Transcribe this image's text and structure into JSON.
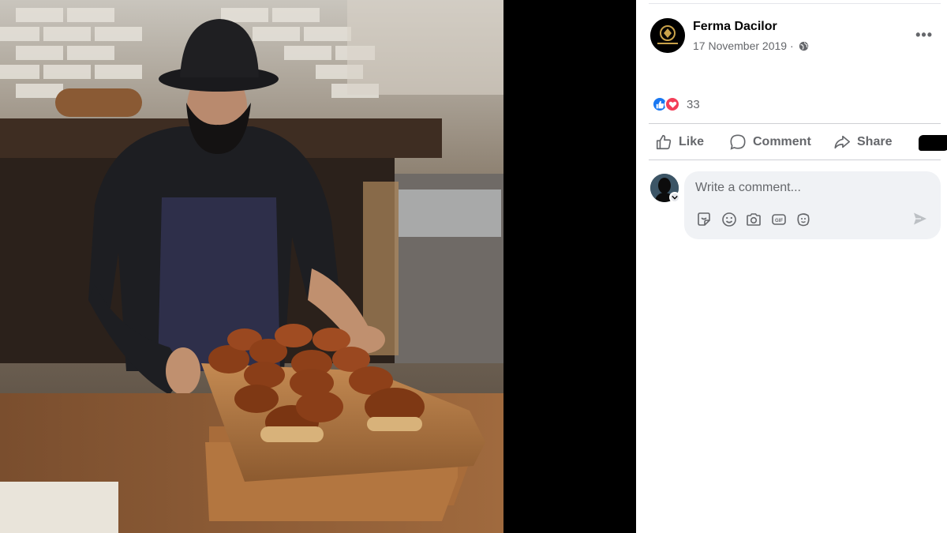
{
  "post": {
    "page_name": "Ferma Dacilor",
    "date": "17 November 2019",
    "date_separator": " · ",
    "more_label": "•••",
    "reaction_count": "33"
  },
  "actions": {
    "like": "Like",
    "comment": "Comment",
    "share": "Share"
  },
  "comment": {
    "placeholder": "Write a comment..."
  },
  "colors": {
    "like_blue": "#1877f2",
    "love_red": "#f33e58",
    "secondary_text": "#65676b",
    "input_bg": "#f0f2f5"
  },
  "icons": [
    "globe-icon",
    "more-icon",
    "like-reaction-icon",
    "love-reaction-icon",
    "thumbs-up-icon",
    "comment-icon",
    "share-icon",
    "sticker-icon",
    "emoji-icon",
    "camera-icon",
    "gif-icon",
    "avatar-sticker-icon",
    "send-icon"
  ]
}
